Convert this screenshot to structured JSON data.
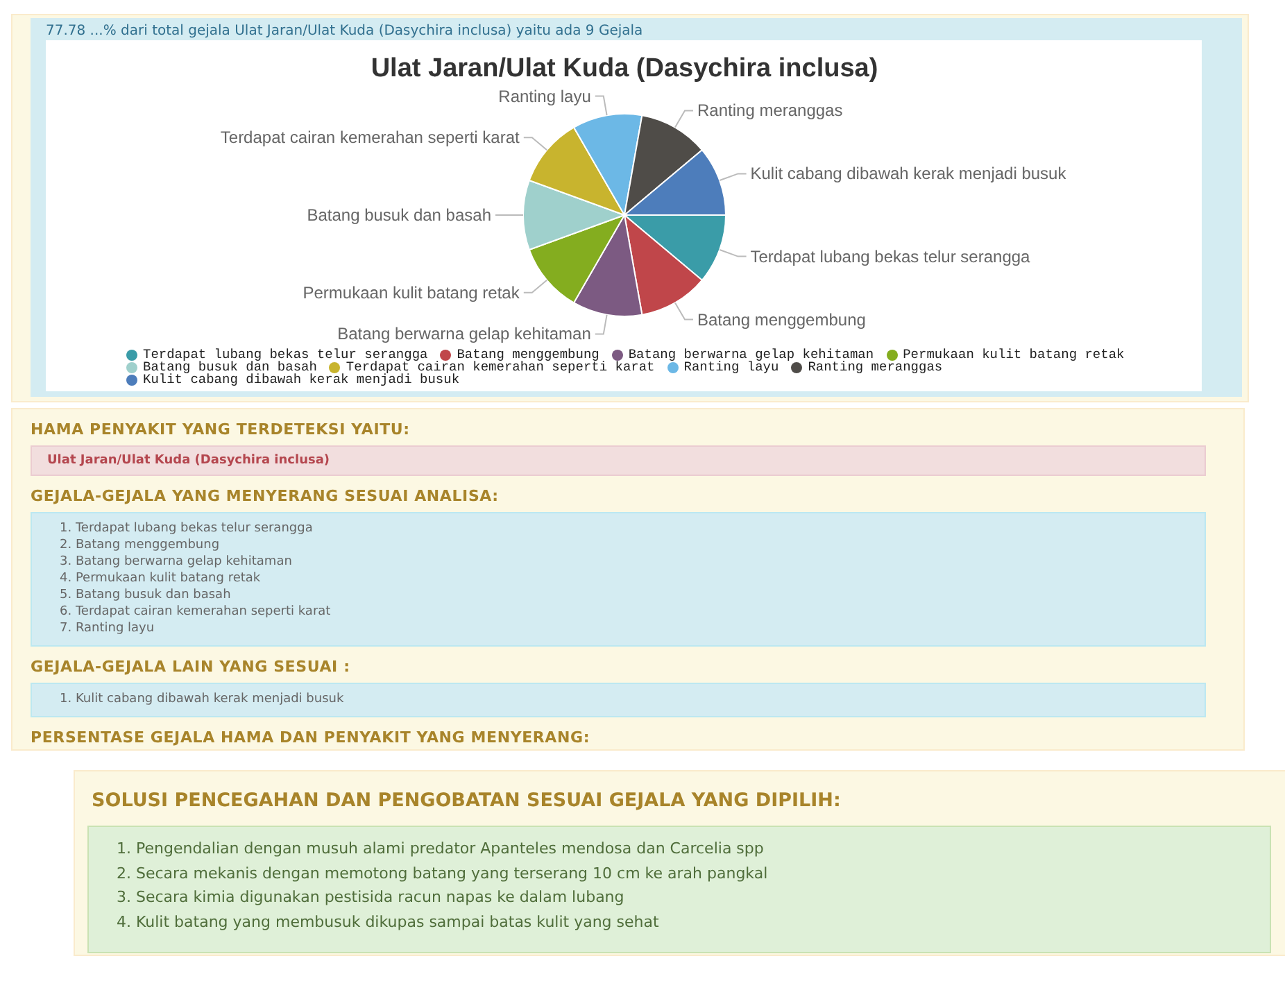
{
  "summary": "77.78 ...% dari total gejala Ulat Jaran/Ulat Kuda (Dasychira inclusa) yaitu ada 9 Gejala",
  "chart_data": {
    "type": "pie",
    "title": "Ulat Jaran/Ulat Kuda (Dasychira inclusa)",
    "categories": [
      "Terdapat lubang bekas telur serangga",
      "Batang menggembung",
      "Batang berwarna gelap kehitaman",
      "Permukaan kulit batang retak",
      "Batang busuk dan basah",
      "Terdapat cairan kemerahan seperti karat",
      "Ranting layu",
      "Ranting meranggas",
      "Kulit cabang dibawah kerak menjadi busuk"
    ],
    "values": [
      11.11,
      11.11,
      11.11,
      11.11,
      11.11,
      11.11,
      11.11,
      11.11,
      11.11
    ],
    "legend": "bottom",
    "colors": [
      "#3a9ca8",
      "#c0464a",
      "#7c5a82",
      "#84ad1f",
      "#9fd0cc",
      "#c8b42e",
      "#6cb8e6",
      "#4f4c48",
      "#4d7dbb"
    ]
  },
  "detected": {
    "heading": "HAMA PENYAKIT YANG TERDETEKSI YAITU:",
    "value": "Ulat Jaran/Ulat Kuda (Dasychira inclusa)"
  },
  "symptoms": {
    "heading": "GEJALA-GEJALA YANG MENYERANG SESUAI ANALISA:",
    "items": [
      "1. Terdapat lubang bekas telur serangga",
      "2. Batang menggembung",
      "3. Batang berwarna gelap kehitaman",
      "4. Permukaan kulit batang retak",
      "5. Batang busuk dan basah",
      "6. Terdapat cairan kemerahan seperti karat",
      "7. Ranting layu"
    ]
  },
  "other_symptoms": {
    "heading": "GEJALA-GEJALA LAIN YANG SESUAI :",
    "items": [
      "1. Kulit cabang dibawah kerak menjadi busuk"
    ]
  },
  "percentage_heading": "PERSENTASE GEJALA HAMA DAN PENYAKIT YANG MENYERANG:",
  "solutions": {
    "heading": "SOLUSI PENCEGAHAN DAN PENGOBATAN SESUAI GEJALA YANG DIPILIH:",
    "items": [
      "1. Pengendalian dengan musuh alami predator Apanteles mendosa dan Carcelia spp",
      "2. Secara mekanis dengan memotong batang yang terserang 10 cm ke arah pangkal",
      "3. Secara kimia digunakan pestisida racun napas ke dalam lubang",
      "4. Kulit batang yang membusuk dikupas sampai batas kulit yang sehat"
    ]
  }
}
